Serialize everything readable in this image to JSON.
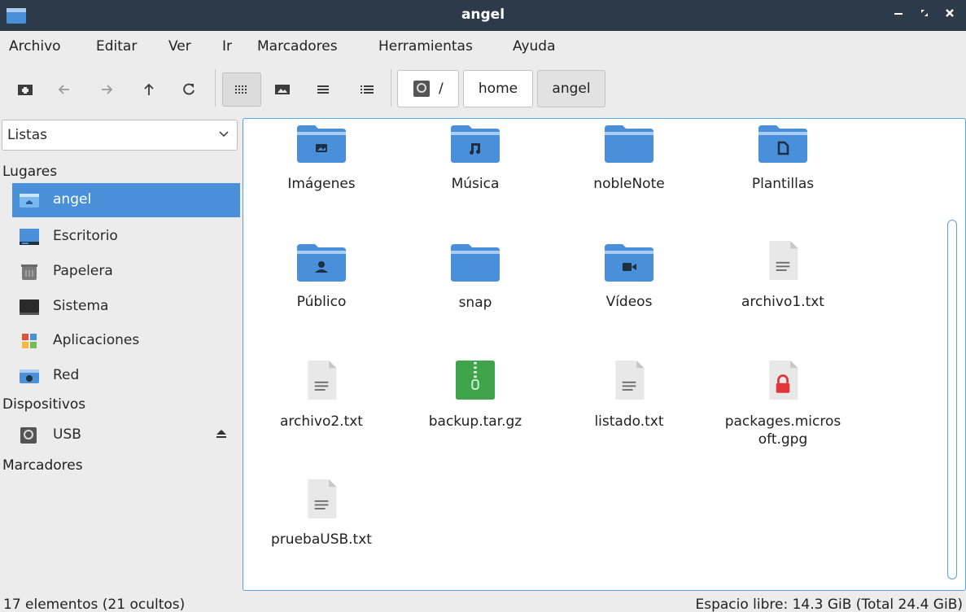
{
  "window": {
    "title": "angel"
  },
  "menu": [
    "Archivo",
    "Editar",
    "Ver",
    "Ir",
    "Marcadores",
    "Herramientas",
    "Ayuda"
  ],
  "breadcrumb": {
    "root": "/",
    "home": "home",
    "current": "angel"
  },
  "sidebar": {
    "view_selector": "Listas",
    "sections": {
      "places": "Lugares",
      "devices": "Dispositivos",
      "bookmarks": "Marcadores"
    },
    "places": [
      {
        "label": "angel",
        "icon": "home-folder-icon",
        "selected": true
      },
      {
        "label": "Escritorio",
        "icon": "desktop-icon"
      },
      {
        "label": "Papelera",
        "icon": "trash-icon"
      },
      {
        "label": "Sistema",
        "icon": "system-icon"
      },
      {
        "label": "Aplicaciones",
        "icon": "applications-icon"
      },
      {
        "label": "Red",
        "icon": "network-icon"
      }
    ],
    "devices": [
      {
        "label": "USB",
        "icon": "usb-drive-icon"
      }
    ]
  },
  "files": [
    {
      "name": "Imágenes",
      "type": "folder-pictures"
    },
    {
      "name": "Música",
      "type": "folder-music"
    },
    {
      "name": "nobleNote",
      "type": "folder"
    },
    {
      "name": "Plantillas",
      "type": "folder-templates"
    },
    {
      "name": "Público",
      "type": "folder-public"
    },
    {
      "name": "snap",
      "type": "folder"
    },
    {
      "name": "Vídeos",
      "type": "folder-videos"
    },
    {
      "name": "archivo1.txt",
      "type": "text"
    },
    {
      "name": "archivo2.txt",
      "type": "text"
    },
    {
      "name": "backup.tar.gz",
      "type": "archive"
    },
    {
      "name": "listado.txt",
      "type": "text"
    },
    {
      "name_line1": "packages.micros",
      "name_line2": "oft.gpg",
      "type": "locked"
    },
    {
      "name": "pruebaUSB.txt",
      "type": "text"
    }
  ],
  "status": {
    "count": "17 elementos (21 ocultos)",
    "space": "Espacio libre: 14.3 GiB (Total 24.4 GiB)"
  },
  "colors": {
    "accent": "#4a90d9",
    "folder": "#4a8fd9",
    "archive": "#3ea34a",
    "lock": "#e0353b",
    "titlebar": "#2d3a4a"
  }
}
